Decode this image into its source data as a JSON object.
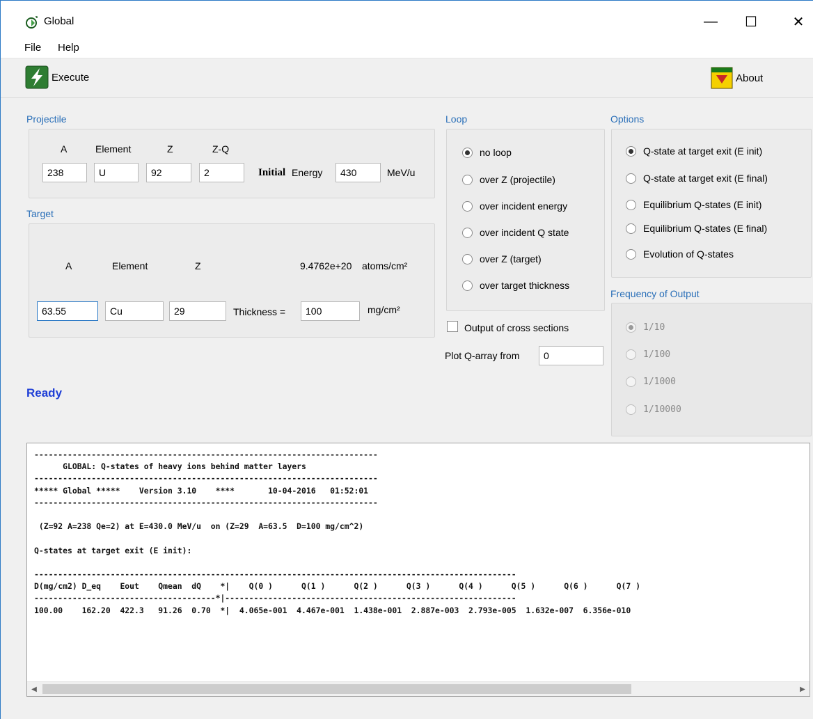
{
  "window": {
    "title": "Global",
    "controls": {
      "minimize": "—",
      "maximize": "☐",
      "close": "✕"
    }
  },
  "menu": {
    "file": "File",
    "help": "Help"
  },
  "toolbar": {
    "execute_label": "Execute",
    "about_label": "About"
  },
  "projectile": {
    "title": "Projectile",
    "headers": {
      "a": "A",
      "element": "Element",
      "z": "Z",
      "zq": "Z-Q"
    },
    "values": {
      "a": "238",
      "element": "U",
      "z": "92",
      "zq": "2"
    },
    "initial_label": "Initial",
    "energy_label": "Energy",
    "energy_value": "430",
    "energy_unit": "MeV/u"
  },
  "target": {
    "title": "Target",
    "headers": {
      "a": "A",
      "element": "Element",
      "z": "Z"
    },
    "density": "9.4762e+20",
    "density_unit": "atoms/cm²",
    "values": {
      "a": "63.55",
      "element": "Cu",
      "z": "29"
    },
    "thickness_label": "Thickness =",
    "thickness_value": "100",
    "thickness_unit": "mg/cm²"
  },
  "status": {
    "text": "Ready",
    "color": "#1f3fd6"
  },
  "loop": {
    "title": "Loop",
    "options": [
      {
        "label": "no loop",
        "checked": true
      },
      {
        "label": "over Z (projectile)",
        "checked": false
      },
      {
        "label": "over incident energy",
        "checked": false
      },
      {
        "label": "over incident Q state",
        "checked": false
      },
      {
        "label": "over Z (target)",
        "checked": false
      },
      {
        "label": "over target thickness",
        "checked": false
      }
    ],
    "cross_sections_label": "Output of cross sections",
    "plot_label": "Plot Q-array from",
    "plot_value": "0"
  },
  "options": {
    "title": "Options",
    "items": [
      {
        "label": "Q-state at target exit (E init)",
        "checked": true
      },
      {
        "label": "Q-state at target exit (E final)",
        "checked": false
      },
      {
        "label": "Equilibrium Q-states (E init)",
        "checked": false
      },
      {
        "label": "Equilibrium Q-states (E final)",
        "checked": false
      },
      {
        "label": "Evolution of Q-states",
        "checked": false
      }
    ]
  },
  "frequency": {
    "title": "Frequency of Output",
    "items": [
      {
        "label": "1/10",
        "checked": true
      },
      {
        "label": "1/100",
        "checked": false
      },
      {
        "label": "1/1000",
        "checked": false
      },
      {
        "label": "1/10000",
        "checked": false
      }
    ]
  },
  "output": {
    "lines": [
      "------------------------------------------------------------------------",
      "      GLOBAL: Q-states of heavy ions behind matter layers",
      "------------------------------------------------------------------------",
      "***** Global *****    Version 3.10    ****       10-04-2016   01:52:01",
      "------------------------------------------------------------------------",
      "",
      " (Z=92 A=238 Qe=2) at E=430.0 MeV/u  on (Z=29  A=63.5  D=100 mg/cm^2)",
      "",
      "Q-states at target exit (E init):",
      "",
      "-----------------------------------------------------------------------------------------------------",
      "D(mg/cm2) D_eq    Eout    Qmean  dQ    *|    Q(0 )      Q(1 )      Q(2 )      Q(3 )      Q(4 )      Q(5 )      Q(6 )      Q(7 )",
      "--------------------------------------*|-------------------------------------------------------------",
      "100.00    162.20  422.3   91.26  0.70  *|  4.065e-001  4.467e-001  1.438e-001  2.887e-003  2.793e-005  1.632e-007  6.356e-010"
    ]
  }
}
